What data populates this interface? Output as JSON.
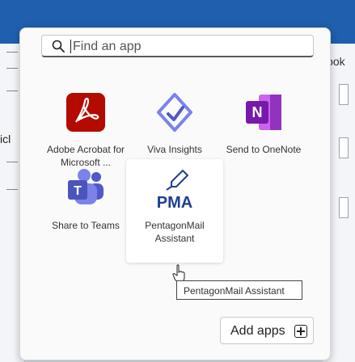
{
  "background": {
    "left_text": "icl",
    "right_text": "look"
  },
  "search": {
    "placeholder": "Find an app"
  },
  "apps": [
    {
      "label": "Adobe Acrobat for Microsoft ...",
      "icon": "adobe-acrobat-icon",
      "color": "#b30b00"
    },
    {
      "label": "Viva Insights",
      "icon": "viva-insights-icon",
      "color": "#7b83eb"
    },
    {
      "label": "Send to OneNote",
      "icon": "onenote-icon",
      "color": "#7719aa"
    },
    {
      "label": "Share to Teams",
      "icon": "teams-icon",
      "color": "#5059c9"
    },
    {
      "label": "PentagonMail Assistant",
      "icon": "pentagonmail-icon",
      "color": "#c62828",
      "logo_text": "PMA"
    }
  ],
  "tooltip": {
    "text": "PentagonMail Assistant"
  },
  "add_apps": {
    "label": "Add apps"
  },
  "colors": {
    "accent": "#1f5fae"
  }
}
